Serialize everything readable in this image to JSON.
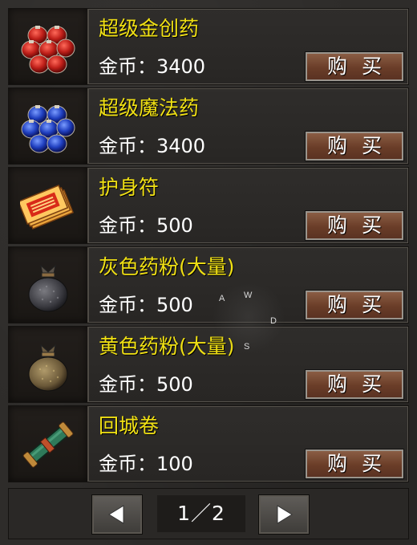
{
  "items": [
    {
      "name": "超级金创药",
      "price": "金币：3400",
      "buy_label": "购买",
      "icon": "red-potion-pack-icon"
    },
    {
      "name": "超级魔法药",
      "price": "金币：3400",
      "buy_label": "购买",
      "icon": "blue-potion-pack-icon"
    },
    {
      "name": "护身符",
      "price": "金币：500",
      "buy_label": "购买",
      "icon": "talisman-icon"
    },
    {
      "name": "灰色药粉(大量)",
      "price": "金币：500",
      "buy_label": "购买",
      "icon": "gray-powder-bag-icon"
    },
    {
      "name": "黄色药粉(大量)",
      "price": "金币：500",
      "buy_label": "购买",
      "icon": "yellow-powder-bag-icon"
    },
    {
      "name": "回城卷",
      "price": "金币：100",
      "buy_label": "购买",
      "icon": "return-scroll-icon"
    }
  ],
  "pagination": {
    "page_text": "1／2",
    "prev_icon": "left-arrow-icon",
    "next_icon": "right-arrow-icon"
  },
  "dpad": {
    "up": "W",
    "left": "A",
    "right": "D",
    "down": "S"
  },
  "colors": {
    "item_name": "#f0e014",
    "price_text": "#ffffff",
    "buy_button": "#6a3d28",
    "panel": "#2e2c2a"
  }
}
